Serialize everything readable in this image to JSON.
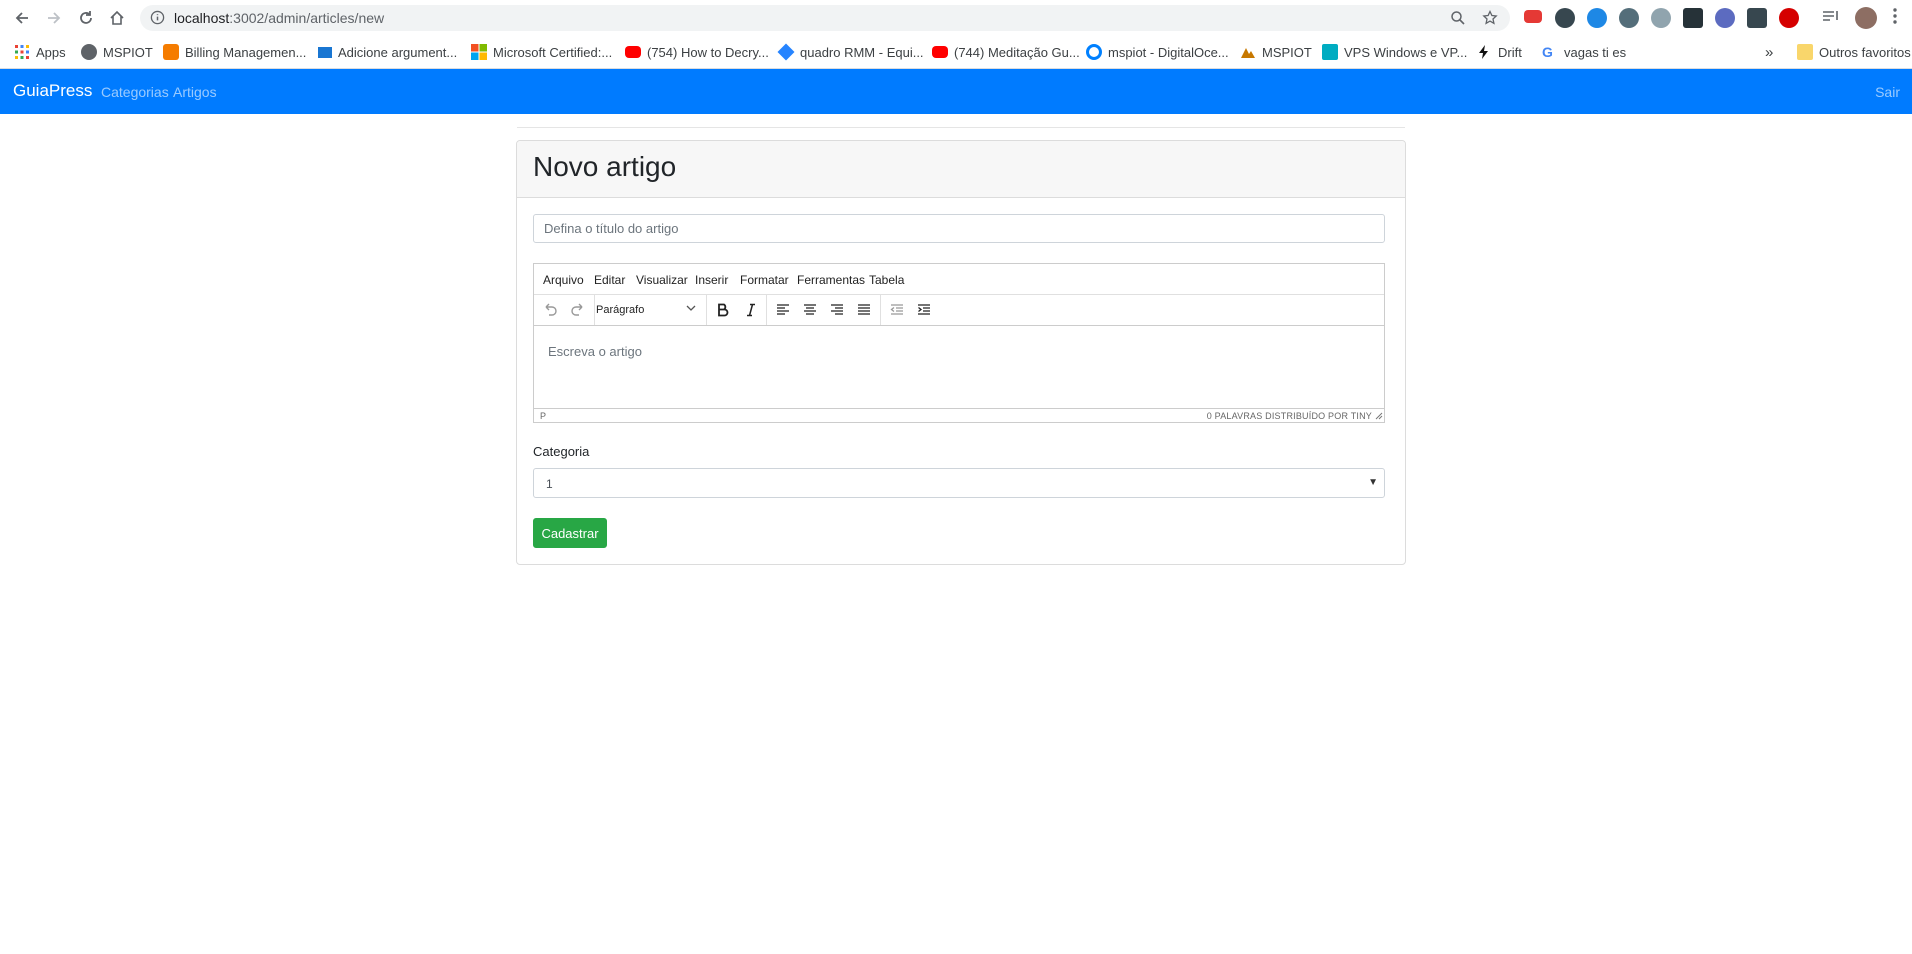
{
  "browser": {
    "url_host": "localhost",
    "url_path": ":3002/admin/articles/new",
    "bookmarks": [
      {
        "label": "Apps",
        "icon": "apps-grid-icon"
      },
      {
        "label": "MSPIOT",
        "icon": "globe-icon"
      },
      {
        "label": "Billing Managemen...",
        "icon": "box-icon"
      },
      {
        "label": "Adicione argument...",
        "icon": "video-icon"
      },
      {
        "label": "Microsoft Certified:...",
        "icon": "microsoft-icon"
      },
      {
        "label": "(754) How to Decry...",
        "icon": "youtube-icon"
      },
      {
        "label": "quadro RMM - Equi...",
        "icon": "jira-icon"
      },
      {
        "label": "(744) Meditação Gu...",
        "icon": "youtube-icon"
      },
      {
        "label": "mspiot - DigitalOce...",
        "icon": "digitalocean-icon"
      },
      {
        "label": "MSPIOT",
        "icon": "mountain-icon"
      },
      {
        "label": "VPS Windows e VP...",
        "icon": "server-icon"
      },
      {
        "label": "Drift",
        "icon": "lightning-icon"
      },
      {
        "label": "vagas ti es",
        "icon": "google-icon"
      }
    ],
    "bookmarks_more": "»",
    "other_bookmarks": "Outros favoritos"
  },
  "navbar": {
    "brand": "GuiaPress",
    "links": [
      "Categorias",
      "Artigos"
    ],
    "logout": "Sair"
  },
  "form": {
    "heading": "Novo artigo",
    "title_placeholder": "Defina o título do artigo",
    "editor": {
      "menu": [
        "Arquivo",
        "Editar",
        "Visualizar",
        "Inserir",
        "Formatar",
        "Ferramentas",
        "Tabela"
      ],
      "block_format": "Parágrafo",
      "placeholder": "Escreva o artigo",
      "status_path": "P",
      "status_right": "0 PALAVRAS  DISTRIBUÍDO POR TINY"
    },
    "category_label": "Categoria",
    "category_value": "1",
    "submit_label": "Cadastrar"
  },
  "colors": {
    "navbar": "#007bff",
    "submit": "#28a745"
  }
}
